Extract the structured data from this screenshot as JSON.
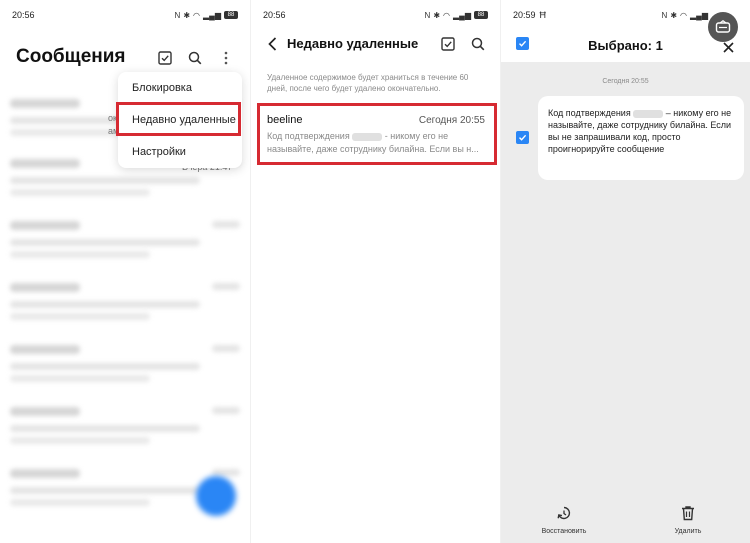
{
  "panel1": {
    "status_time": "20:56",
    "status_battery": "88",
    "title": "Сообщения",
    "menu": [
      {
        "label": "Блокировка"
      },
      {
        "label": "Недавно удаленные"
      },
      {
        "label": "Настройки"
      }
    ],
    "side_fragments": {
      "ok": "ок",
      "am": "ам",
      "yesterday": "Вчера 21:47"
    }
  },
  "panel2": {
    "status_time": "20:56",
    "status_battery": "88",
    "title": "Недавно удаленные",
    "info_text": "Удаленное содержимое будет храниться в течение 60 дней, после чего будет удалено окончательно.",
    "message": {
      "sender": "beeline",
      "date": "Сегодня 20:55",
      "preview_part1": "Код подтверждения",
      "preview_part2": "- никому его не называйте, даже сотруднику билайна. Если вы н..."
    }
  },
  "panel3": {
    "status_time": "20:59",
    "title": "Выбрано: 1",
    "date_label": "Сегодня 20:55",
    "bubble_part1": "Код подтверждения",
    "bubble_part2": "– никому его не называйте, даже сотруднику билайна. Если вы не запрашивали код, просто проигнорируйте сообщение",
    "restore_label": "Восстановить",
    "delete_label": "Удалить"
  },
  "colors": {
    "accent": "#2a86f5",
    "highlight": "#d62a32"
  }
}
